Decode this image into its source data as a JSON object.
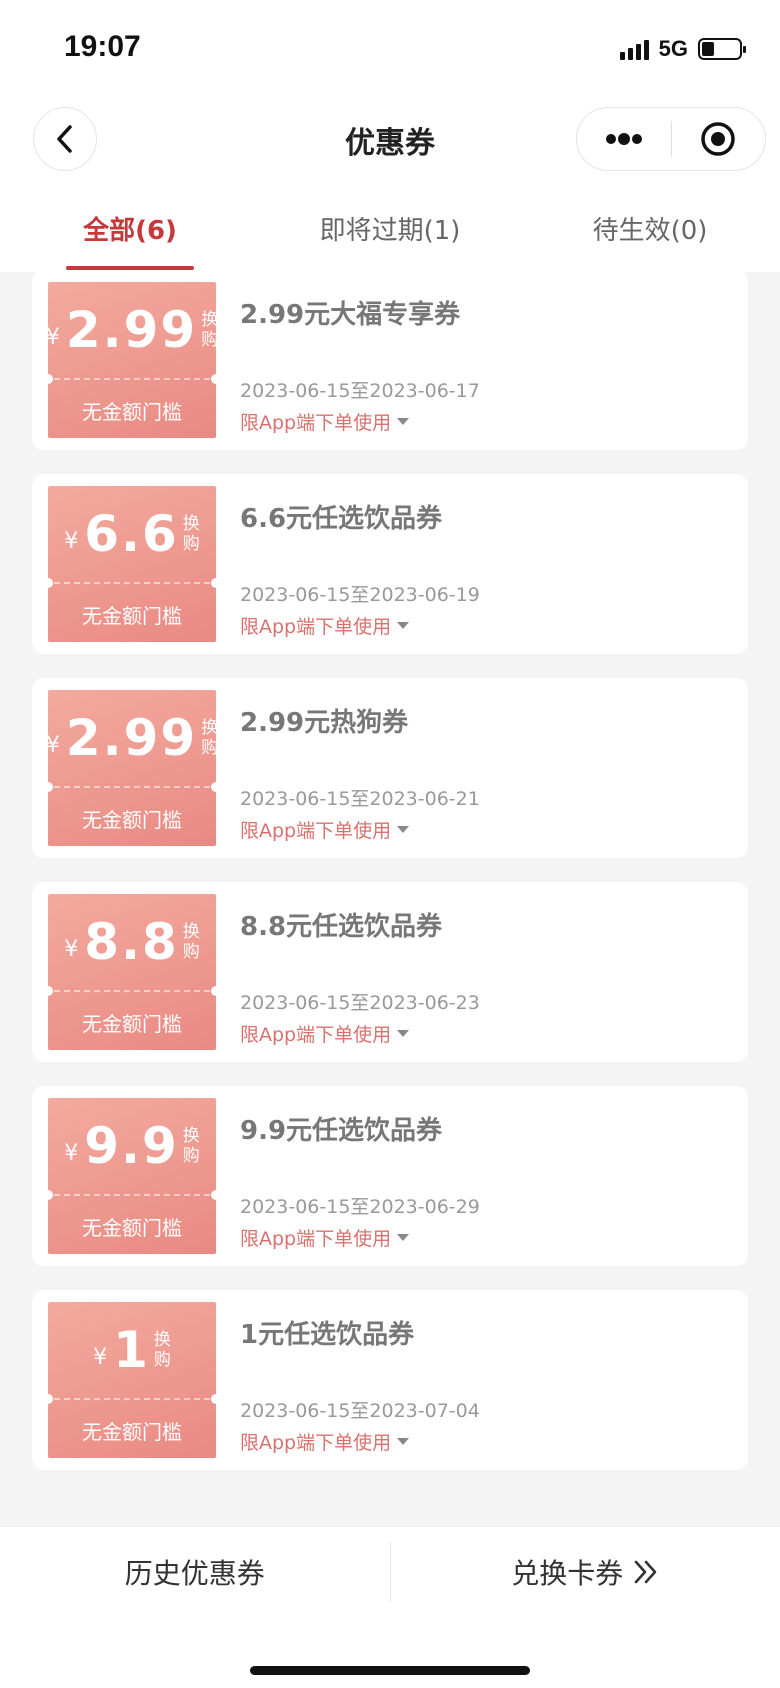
{
  "status": {
    "time": "19:07",
    "network": "5G"
  },
  "nav": {
    "title": "优惠券"
  },
  "tabs": [
    {
      "label": "全部(6)",
      "active": true
    },
    {
      "label": "即将过期(1)",
      "active": false
    },
    {
      "label": "待生效(0)",
      "active": false
    }
  ],
  "coupons": [
    {
      "currency": "¥",
      "amount": "2.99",
      "tag1": "换",
      "tag2": "购",
      "threshold": "无金额门槛",
      "title": "2.99元大福专享券",
      "date": "2023-06-15至2023-06-17",
      "limit": "限App端下单使用"
    },
    {
      "currency": "¥",
      "amount": "6.6",
      "tag1": "换",
      "tag2": "购",
      "threshold": "无金额门槛",
      "title": "6.6元任选饮品券",
      "date": "2023-06-15至2023-06-19",
      "limit": "限App端下单使用"
    },
    {
      "currency": "¥",
      "amount": "2.99",
      "tag1": "换",
      "tag2": "购",
      "threshold": "无金额门槛",
      "title": "2.99元热狗券",
      "date": "2023-06-15至2023-06-21",
      "limit": "限App端下单使用"
    },
    {
      "currency": "¥",
      "amount": "8.8",
      "tag1": "换",
      "tag2": "购",
      "threshold": "无金额门槛",
      "title": "8.8元任选饮品券",
      "date": "2023-06-15至2023-06-23",
      "limit": "限App端下单使用"
    },
    {
      "currency": "¥",
      "amount": "9.9",
      "tag1": "换",
      "tag2": "购",
      "threshold": "无金额门槛",
      "title": "9.9元任选饮品券",
      "date": "2023-06-15至2023-06-29",
      "limit": "限App端下单使用"
    },
    {
      "currency": "¥",
      "amount": "1",
      "tag1": "换",
      "tag2": "购",
      "threshold": "无金额门槛",
      "title": "1元任选饮品券",
      "date": "2023-06-15至2023-07-04",
      "limit": "限App端下单使用"
    }
  ],
  "bottom": {
    "history_label": "历史优惠券",
    "exchange_label": "兑换卡券"
  },
  "colors": {
    "accent": "#c6393b",
    "stub_start": "#f4aa9e",
    "stub_end": "#e88a83",
    "limit_text": "#d9726e"
  }
}
